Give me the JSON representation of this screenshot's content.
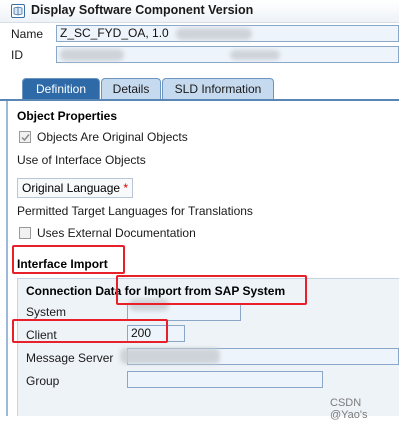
{
  "window": {
    "title": "Display Software Component Version"
  },
  "header": {
    "name_label": "Name",
    "name_value": "Z_SC_FYD_OA, 1.0",
    "id_label": "ID"
  },
  "tabs": [
    {
      "label": "Definition",
      "active": true
    },
    {
      "label": "Details",
      "active": false
    },
    {
      "label": "SLD Information",
      "active": false
    }
  ],
  "object_properties": {
    "title": "Object Properties",
    "original_objects_label": "Objects Are Original Objects",
    "original_objects_checked": true,
    "use_of_interface_label": "Use of Interface Objects",
    "original_language_label": "Original Language",
    "required_marker": "*",
    "permitted_languages_label": "Permitted Target Languages for Translations",
    "external_doc_label": "Uses External Documentation",
    "external_doc_checked": false
  },
  "interface_import": {
    "title": "Interface Import",
    "connection_title": "Connection Data for Import from SAP System",
    "system_label": "System",
    "client_label": "Client",
    "client_value": "200",
    "message_server_label": "Message Server",
    "group_label": "Group"
  },
  "watermark": "CSDN @Yao's",
  "colors": {
    "tab_active": "#2f6aa8",
    "tab_inactive": "#c6daef",
    "field_bg": "#eef4fb",
    "highlight_red": "#e8202a"
  }
}
